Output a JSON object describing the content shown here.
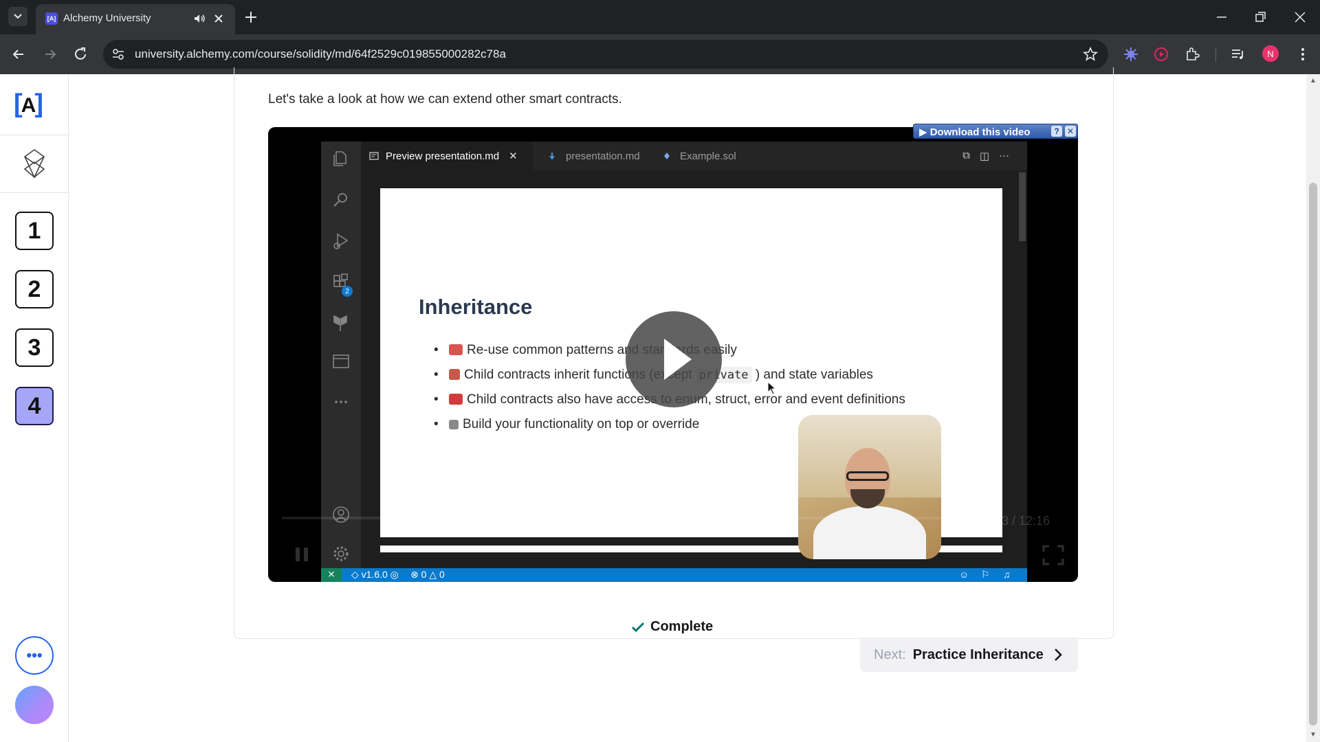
{
  "browser": {
    "tab_title": "Alchemy University",
    "favicon_text": "[A]",
    "url": "university.alchemy.com/course/solidity/md/64f2529c019855000282c78a",
    "profile_initial": "N"
  },
  "sidebar": {
    "logo_left": "[",
    "logo_mark": "A",
    "logo_right": "]",
    "modules": [
      "1",
      "2",
      "3",
      "4"
    ],
    "active_module": "4",
    "more_label": "•••"
  },
  "content": {
    "intro": "Let's take a look at how we can extend other smart contracts.",
    "download_label": "▶ Download this video",
    "download_help": "?",
    "download_close": "✕",
    "video": {
      "editor_tabs": [
        "Preview presentation.md",
        "presentation.md",
        "Example.sol"
      ],
      "extensions_badge": "2",
      "slide_title": "Inheritance",
      "bullets": [
        "Re-use common patterns and standards easily",
        "Child contracts inherit functions (except",
        "Child contracts also have access to enum, struct, error and event definitions",
        "Build your functionality on top or override"
      ],
      "bullet_code": "private",
      "bullet_suffix": ") and state variables",
      "status_version": "v1.6.0",
      "status_errors": "0",
      "status_warnings": "0",
      "time": "0:03 / 12:16"
    },
    "complete_label": "Complete",
    "next_prefix": "Next:",
    "next_title": "Practice Inheritance"
  },
  "colors": {
    "accent_blue": "#2563eb",
    "active_module_bg": "#a5a6f6",
    "vscode_status": "#0a7acc"
  }
}
